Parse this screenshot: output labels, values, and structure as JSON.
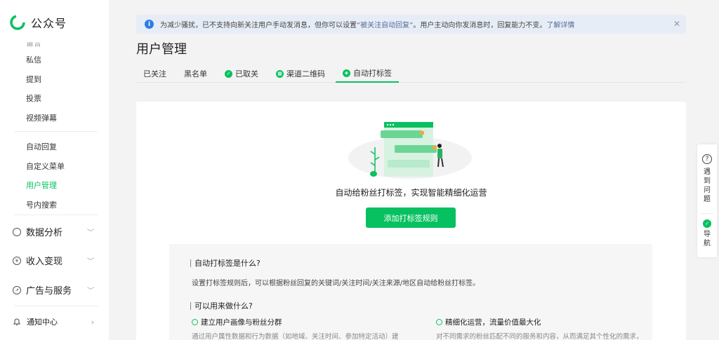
{
  "app": {
    "name": "公众号"
  },
  "sidebar": {
    "partial_item": "留言",
    "items": [
      {
        "label": "私信"
      },
      {
        "label": "提到"
      },
      {
        "label": "投票"
      },
      {
        "label": "视频弹幕"
      },
      {
        "label": "自动回复"
      },
      {
        "label": "自定义菜单"
      },
      {
        "label": "用户管理"
      },
      {
        "label": "号内搜索"
      }
    ],
    "groups": [
      {
        "label": "数据分析"
      },
      {
        "label": "收入变现"
      },
      {
        "label": "广告与服务"
      }
    ],
    "notify": "通知中心",
    "active_color": "#07c160"
  },
  "notice": {
    "text_before": "为减少骚扰，已不支持向新关注用户手动发消息，但你可以设置",
    "link1": "“被关注自动回复”",
    "text_after": "。用户主动向你发消息时，回复能力不变。",
    "link2": "了解详情"
  },
  "page": {
    "title": "用户管理"
  },
  "tabs": [
    {
      "label": "已关注"
    },
    {
      "label": "黑名单"
    },
    {
      "label": "已取关"
    },
    {
      "label": "渠道二维码"
    },
    {
      "label": "自动打标签"
    }
  ],
  "main": {
    "headline": "自动给粉丝打标签，实现智能精细化运营",
    "primary_button": "添加打标签规则"
  },
  "faq": {
    "q1": "自动打标签是什么?",
    "a1": "设置打标签规则后，可以根据粉丝回复的关键词/关注时间/关注来源/地区自动给粉丝打标签。",
    "q2": "可以用来做什么?",
    "sub1": "建立用户画像与粉丝分群",
    "sub1_desc": "通过用户属性数据和行为数据（如地域、关注时间、参加特定活动）建",
    "sub2": "精细化运营，流量价值最大化",
    "sub2_desc": "对不同需求的粉丝匹配不同的服务和内容，从而满足其个性化的需求，"
  },
  "float_help": {
    "label1": "遇到问题",
    "label2": "导航"
  }
}
